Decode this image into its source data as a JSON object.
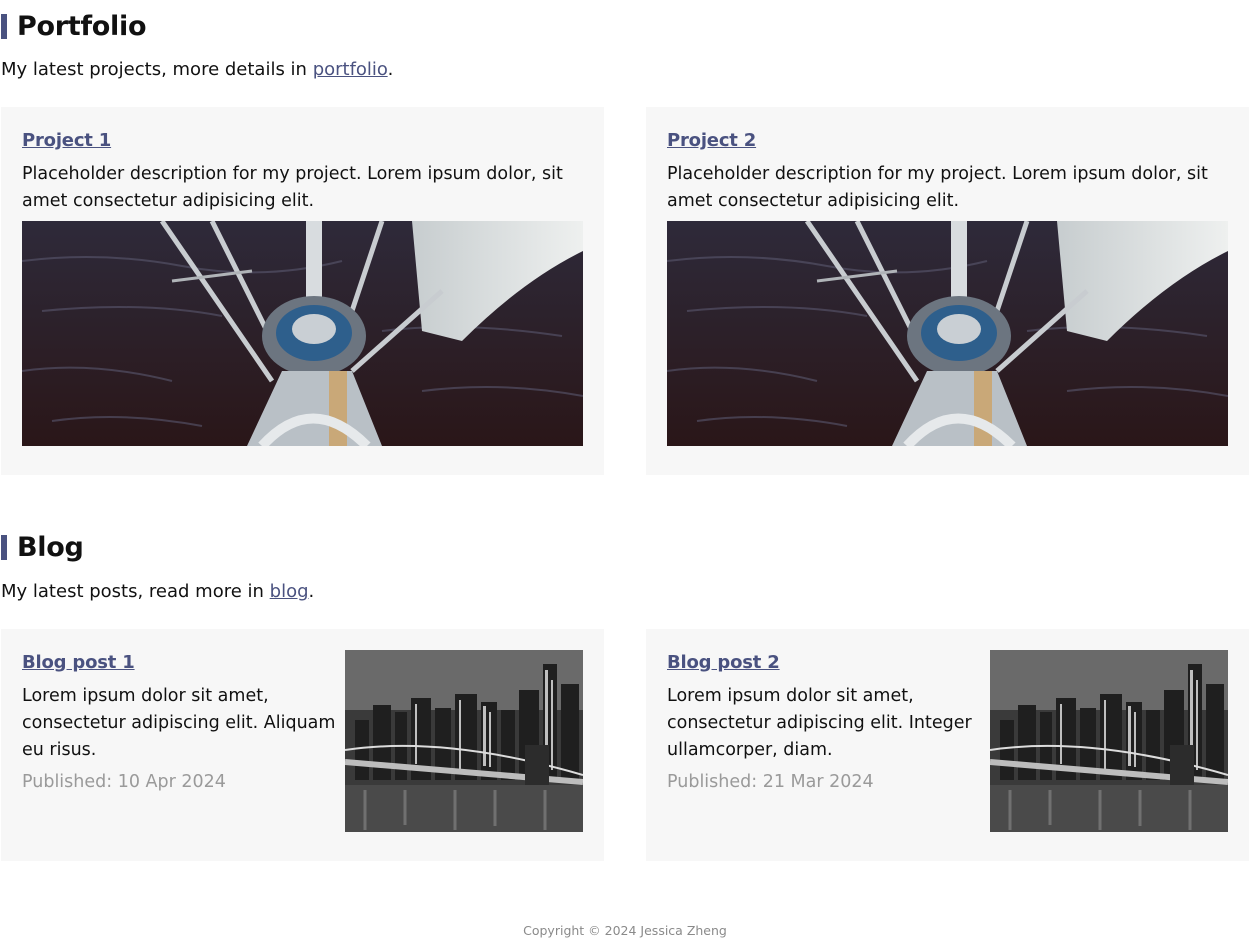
{
  "portfolio": {
    "heading": "Portfolio",
    "intro_prefix": "My latest projects, more details in ",
    "intro_link": "portfolio",
    "intro_suffix": ".",
    "projects": [
      {
        "title": "Project 1",
        "description": "Placeholder description for my project. Lorem ipsum dolor, sit amet consectetur adipisicing elit."
      },
      {
        "title": "Project 2",
        "description": "Placeholder description for my project. Lorem ipsum dolor, sit amet consectetur adipisicing elit."
      }
    ]
  },
  "blog": {
    "heading": "Blog",
    "intro_prefix": "My latest posts, read more in ",
    "intro_link": "blog",
    "intro_suffix": ".",
    "posts": [
      {
        "title": "Blog post 1",
        "excerpt": "Lorem ipsum dolor sit amet, consectetur adipiscing elit. Aliquam eu risus.",
        "published": "Published: 10 Apr 2024"
      },
      {
        "title": "Blog post 2",
        "excerpt": "Lorem ipsum dolor sit amet, consectetur adipiscing elit. Integer ullamcorper, diam.",
        "published": "Published: 21 Mar 2024"
      }
    ]
  },
  "footer": {
    "copyright": "Copyright © 2024 Jessica Zheng"
  },
  "colors": {
    "accent": "#4a5280",
    "card_background": "#f7f7f7",
    "muted_text": "#9a9a9a"
  }
}
